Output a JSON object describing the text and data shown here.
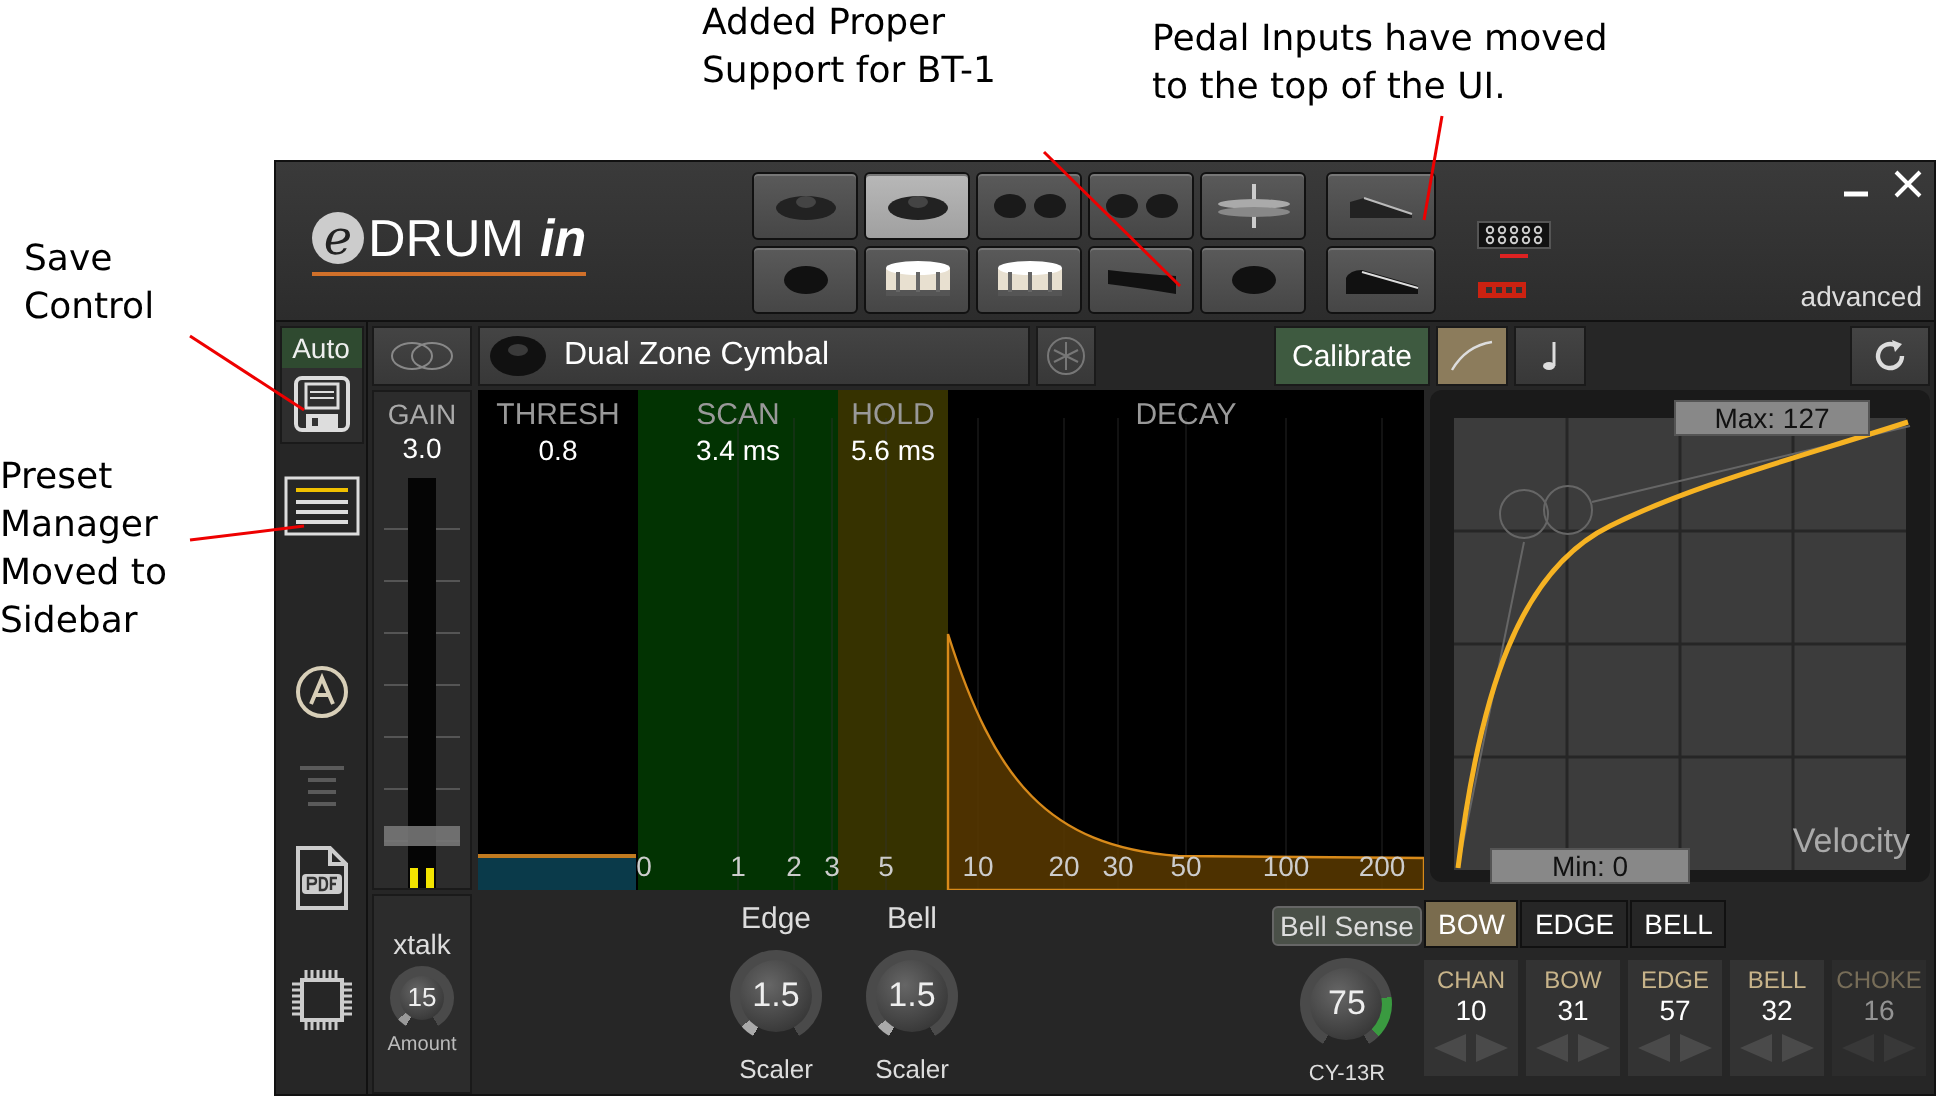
{
  "annotations": {
    "top": [
      {
        "text": "Added Proper\nSupport for BT-1"
      },
      {
        "text": "Pedal Inputs have moved\nto the top of the UI."
      }
    ],
    "left": [
      {
        "text": "Save\nControl"
      },
      {
        "text": "Preset\nManager\nMoved to\nSidebar"
      }
    ]
  },
  "header": {
    "logo": {
      "letter": "e",
      "word": "DRUM",
      "suffix": "in"
    },
    "pads": [
      {
        "kind": "cymbal",
        "selected": false
      },
      {
        "kind": "cymbal",
        "selected": true
      },
      {
        "kind": "dual",
        "selected": false
      },
      {
        "kind": "dual",
        "selected": false
      },
      {
        "kind": "hihat",
        "selected": false
      },
      {
        "kind": "pad",
        "selected": false
      },
      {
        "kind": "snare",
        "selected": false
      },
      {
        "kind": "snare",
        "selected": false
      },
      {
        "kind": "bar",
        "selected": false
      },
      {
        "kind": "pad",
        "selected": false
      }
    ],
    "pedals": [
      {
        "kind": "pedal-open",
        "selected": false
      },
      {
        "kind": "pedal-closed",
        "selected": false
      }
    ],
    "mode": "advanced"
  },
  "sidebar": {
    "auto": "Auto",
    "items": [
      {
        "kind": "save",
        "disabled": false
      },
      {
        "kind": "presets",
        "disabled": false
      },
      {
        "kind": "auto",
        "disabled": false
      },
      {
        "kind": "lines",
        "disabled": true
      },
      {
        "kind": "pdf",
        "disabled": false
      },
      {
        "kind": "chip",
        "disabled": false
      }
    ]
  },
  "toolbar": {
    "pad_name": "Dual Zone Cymbal",
    "calibrate": "Calibrate",
    "modes": [
      {
        "kind": "curve",
        "selected": true
      },
      {
        "kind": "note",
        "selected": false
      }
    ]
  },
  "gain": {
    "label": "GAIN",
    "value": "3.0",
    "level": 0.1
  },
  "xtalk": {
    "label": "xtalk",
    "value": "15",
    "caption": "Amount"
  },
  "trigger": {
    "sections": [
      {
        "kind": "thresh",
        "label": "THRESH",
        "value": "0.8"
      },
      {
        "kind": "scan",
        "label": "SCAN",
        "value": "3.4 ms"
      },
      {
        "kind": "hold",
        "label": "HOLD",
        "value": "5.6 ms"
      },
      {
        "kind": "decay",
        "label": "DECAY"
      }
    ],
    "x_labels": [
      "0",
      "1",
      "2",
      "3",
      "5",
      "10",
      "20",
      "30",
      "50",
      "100",
      "200"
    ]
  },
  "velocity": {
    "max": "Max: 127",
    "min": "Min: 0",
    "label": "Velocity"
  },
  "scalers": [
    {
      "title": "Edge",
      "value": "1.5",
      "caption": "Scaler"
    },
    {
      "title": "Bell",
      "value": "1.5",
      "caption": "Scaler"
    }
  ],
  "bell_sense": {
    "button": "Bell Sense",
    "value": "75",
    "caption": "CY-13R"
  },
  "zones": [
    {
      "label": "BOW",
      "selected": true
    },
    {
      "label": "EDGE",
      "selected": false
    },
    {
      "label": "BELL",
      "selected": false
    }
  ],
  "midi": [
    {
      "label": "CHAN",
      "value": "10",
      "disabled": false
    },
    {
      "label": "BOW",
      "value": "31",
      "disabled": false
    },
    {
      "label": "EDGE",
      "value": "57",
      "disabled": false
    },
    {
      "label": "BELL",
      "value": "32",
      "disabled": false
    },
    {
      "label": "CHOKE",
      "value": "16",
      "disabled": true
    }
  ]
}
